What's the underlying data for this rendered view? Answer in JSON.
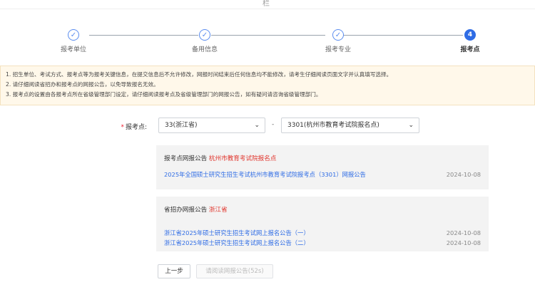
{
  "header": {
    "glyph": "栏"
  },
  "steps": [
    {
      "label": "报考单位",
      "state": "done"
    },
    {
      "label": "备用信息",
      "state": "done"
    },
    {
      "label": "报考专业",
      "state": "done"
    },
    {
      "label": "报考点",
      "state": "active",
      "number": "4"
    }
  ],
  "notice": [
    "1. 招生单位、考试方式、报考点等为报考关键信息，在提交信息后不允许修改，网报时间结束后任何信息均不能修改，请考生仔细阅读页面文字并认真填写选择。",
    "2. 请仔细阅读省招办和报考点的网报公告，以免导致报名无效。",
    "3. 报考点的设置由各报考点所在省级管理部门设定，请仔细阅读报考点及省级管理部门的网报公告，如有疑问请咨询省级管理部门。"
  ],
  "form": {
    "label": "报考点:",
    "required_mark": "*",
    "province_select": "33(浙江省)",
    "separator": "-",
    "site_select": "3301(杭州市教育考试院报名点)"
  },
  "site_panel": {
    "title": "报考点网报公告",
    "highlight": "杭州市教育考试院报名点",
    "items": [
      {
        "text": "2025年全国硕士研究生招生考试杭州市教育考试院报考点（3301）网报公告",
        "date": "2024-10-08"
      }
    ]
  },
  "province_panel": {
    "title": "省招办网报公告",
    "highlight": "浙江省",
    "items": [
      {
        "text": "浙江省2025年硕士研究生招生考试网上报名公告（一）",
        "date": "2024-10-08"
      },
      {
        "text": "浙江省2025年硕士研究生招生考试网上报名公告（二）",
        "date": "2024-10-08"
      }
    ]
  },
  "buttons": {
    "prev": "上一步",
    "read": "请阅读网报公告(52s)"
  },
  "colors": {
    "accent": "#2f6ce5",
    "highlight": "#e0342c",
    "notice_bg": "#fff8ea"
  }
}
